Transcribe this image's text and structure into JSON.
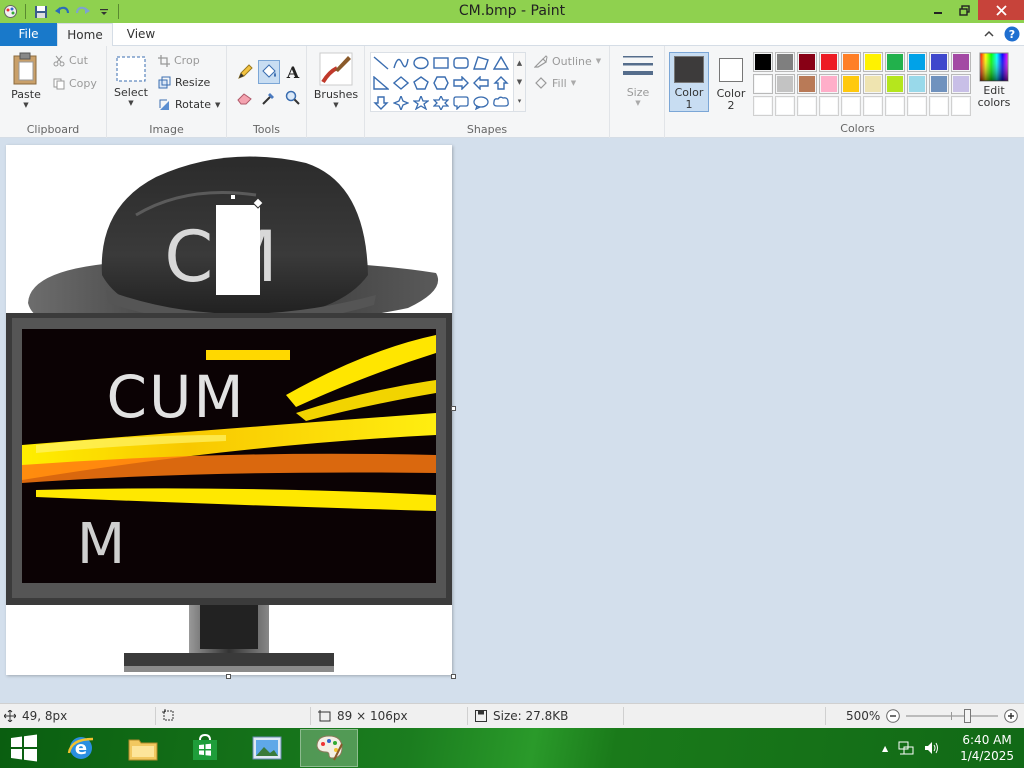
{
  "window": {
    "title": "CM.bmp - Paint"
  },
  "tabs": {
    "file": "File",
    "home": "Home",
    "view": "View"
  },
  "clipboard": {
    "paste": "Paste",
    "cut": "Cut",
    "copy": "Copy",
    "label": "Clipboard"
  },
  "image": {
    "select": "Select",
    "crop": "Crop",
    "resize": "Resize",
    "rotate": "Rotate",
    "label": "Image"
  },
  "tools": {
    "label": "Tools"
  },
  "brushes": {
    "label": "Brushes"
  },
  "shapes": {
    "outline": "Outline",
    "fill": "Fill",
    "label": "Shapes"
  },
  "size": {
    "label": "Size"
  },
  "color_slots": {
    "color1_line1": "Color",
    "color1_line2": "1",
    "color2_line1": "Color",
    "color2_line2": "2",
    "color1": "#3d3b3b",
    "color2": "#ffffff"
  },
  "colors": {
    "label": "Colors",
    "edit_line1": "Edit",
    "edit_line2": "colors",
    "row1": [
      "#000000",
      "#7f7f7f",
      "#880015",
      "#ed1c24",
      "#ff7f27",
      "#fff200",
      "#22b14c",
      "#00a2e8",
      "#3f48cc",
      "#a349a4"
    ],
    "row2": [
      "#ffffff",
      "#c3c3c3",
      "#b97a57",
      "#ffaec9",
      "#ffc90e",
      "#efe4b0",
      "#b5e61d",
      "#99d9ea",
      "#7092be",
      "#c8bfe7"
    ],
    "row3": [
      "#ffffff",
      "#ffffff",
      "#ffffff",
      "#ffffff",
      "#ffffff",
      "#ffffff",
      "#ffffff",
      "#ffffff",
      "#ffffff",
      "#ffffff"
    ]
  },
  "canvas": {
    "hat_text": "CM",
    "screen_text_top": "CUM",
    "screen_text_bottom": "M"
  },
  "status": {
    "cursor_pos": "49, 8px",
    "image_size": "89 × 106px",
    "file_size": "Size: 27.8KB",
    "zoom": "500%",
    "zoom_level": 0.5
  },
  "taskbar": {
    "time": "6:40 AM",
    "date": "1/4/2025"
  }
}
